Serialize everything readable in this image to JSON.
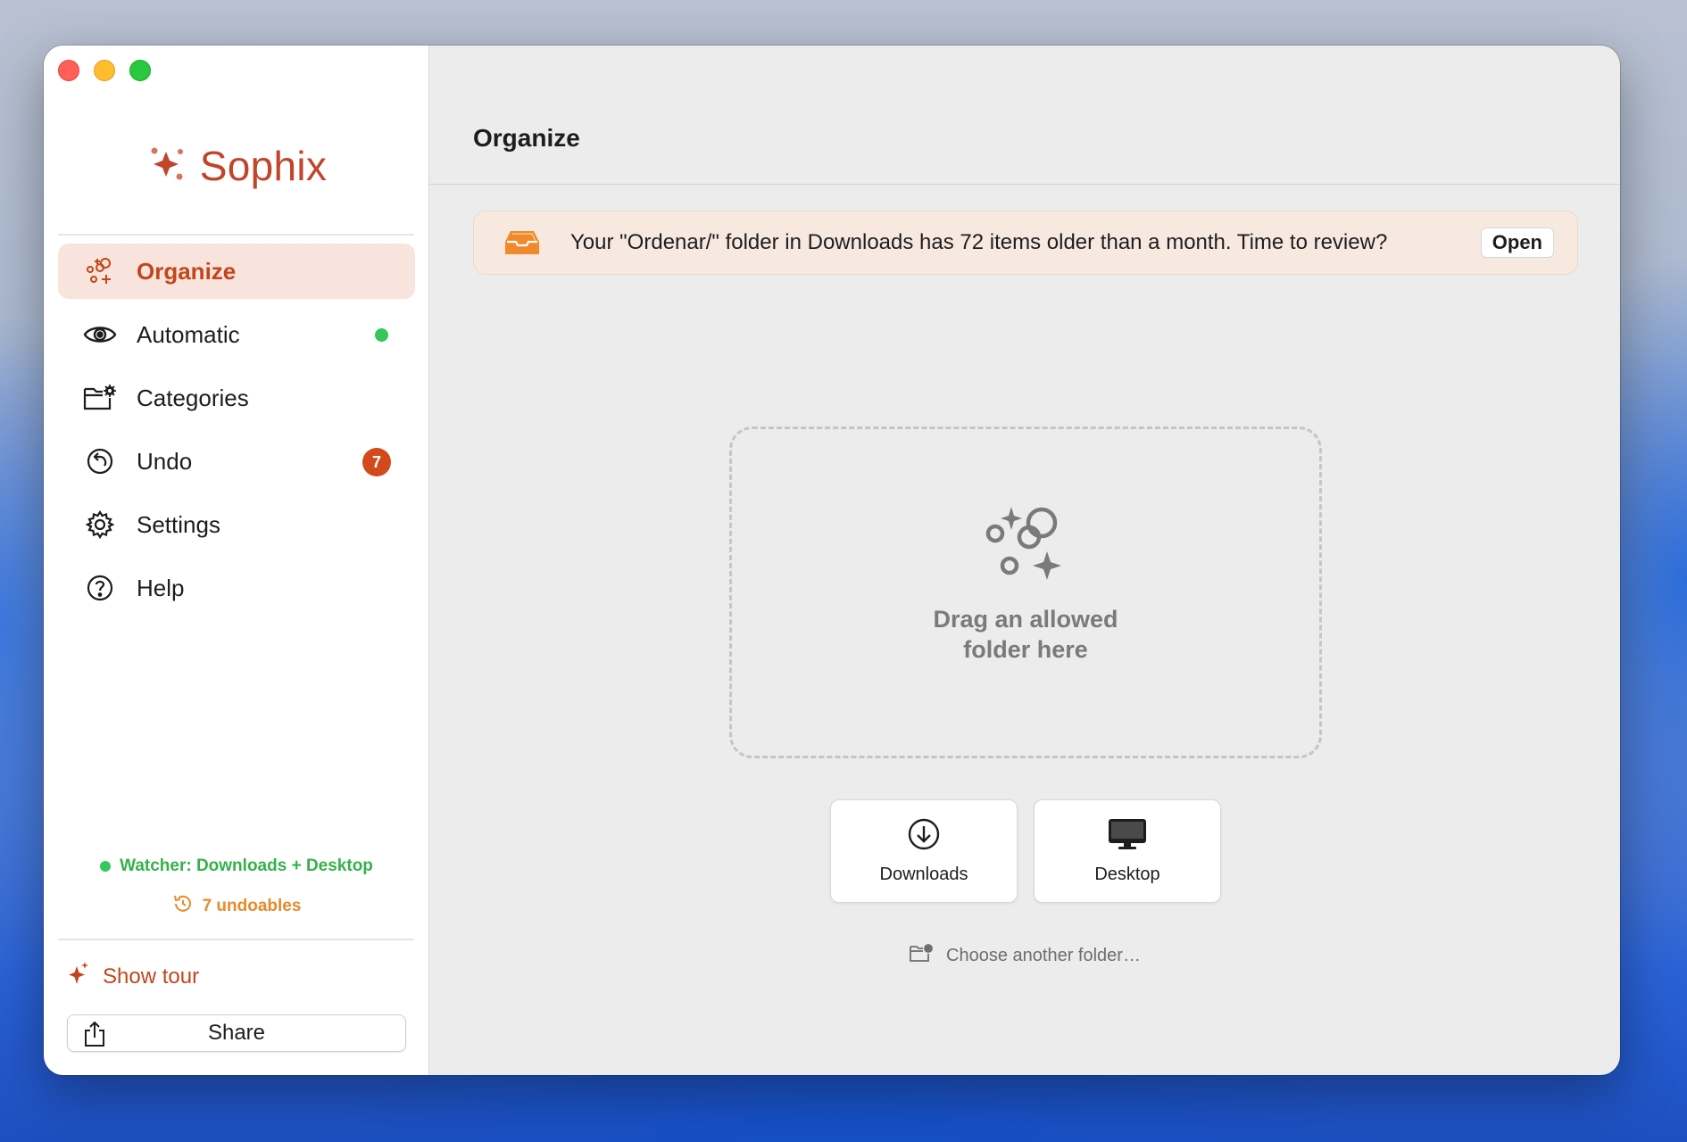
{
  "app": {
    "name": "Sophix",
    "brand_color": "#c1452b"
  },
  "sidebar": {
    "items": [
      {
        "label": "Organize",
        "icon": "organize-sparkle-icon",
        "active": true
      },
      {
        "label": "Automatic",
        "icon": "eye-icon",
        "indicator": "green-dot"
      },
      {
        "label": "Categories",
        "icon": "folder-gear-icon"
      },
      {
        "label": "Undo",
        "icon": "undo-icon",
        "badge": "7"
      },
      {
        "label": "Settings",
        "icon": "gear-icon"
      },
      {
        "label": "Help",
        "icon": "help-icon"
      }
    ],
    "watcher_text": "Watcher: Downloads + Desktop",
    "undoables_text": "7 undoables",
    "show_tour_label": "Show tour",
    "share_label": "Share",
    "colors": {
      "active_bg": "#f9e4dd",
      "active_text": "#c4451b",
      "watcher_green": "#34b24a",
      "undo_orange": "#e8892b",
      "badge_bg": "#d24a1b"
    }
  },
  "main": {
    "title": "Organize",
    "banner": {
      "text": "Your \"Ordenar/\" folder in Downloads has 72 items older than a month. Time to review?",
      "button_label": "Open",
      "icon": "inbox-tray-icon"
    },
    "dropzone": {
      "text": "Drag an allowed folder here",
      "icon": "organize-sparkle-icon"
    },
    "quick_folders": [
      {
        "label": "Downloads",
        "icon": "download-circle-icon"
      },
      {
        "label": "Desktop",
        "icon": "desktop-monitor-icon"
      }
    ],
    "choose_label": "Choose another folder…"
  }
}
